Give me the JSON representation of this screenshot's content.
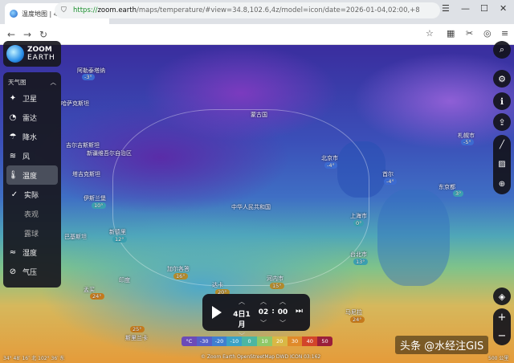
{
  "browser": {
    "tab_title": "温度地图 | 4日 1月，02:00 |",
    "tab_close": "×",
    "new_tab": "+",
    "url_scheme": "https://",
    "url_host": "zoom.earth",
    "url_path": "/maps/temperature/#view=34.8,102.6,4z/model=icon/date=2026-01-04,02:00,+8"
  },
  "logo": {
    "line1": "ZOOM",
    "line2": "EARTH"
  },
  "panel": {
    "header": "天气图",
    "items": [
      {
        "label": "卫星",
        "icon": "satellite-icon"
      },
      {
        "label": "雷达",
        "icon": "radar-icon"
      },
      {
        "label": "降水",
        "icon": "rain-icon"
      },
      {
        "label": "风",
        "icon": "wind-icon"
      },
      {
        "label": "温度",
        "icon": "thermometer-icon"
      },
      {
        "label": "实际",
        "icon": "check-icon"
      },
      {
        "label": "表观",
        "icon": ""
      },
      {
        "label": "露球",
        "icon": ""
      },
      {
        "label": "湿度",
        "icon": "humidity-icon"
      },
      {
        "label": "气压",
        "icon": "pressure-icon"
      }
    ]
  },
  "places": [
    {
      "name": "阿勒泰塔纳",
      "temp": "-3°"
    },
    {
      "name": "新疆维吾尔自治区",
      "temp": ""
    },
    {
      "name": "蒙古国",
      "temp": ""
    },
    {
      "name": "吉尔吉斯斯坦",
      "temp": ""
    },
    {
      "name": "哈萨克斯坦",
      "temp": ""
    },
    {
      "name": "塔吉克斯坦",
      "temp": ""
    },
    {
      "name": "伊斯兰堡",
      "temp": "10°"
    },
    {
      "name": "巴基斯坦",
      "temp": ""
    },
    {
      "name": "新德里",
      "temp": "12°"
    },
    {
      "name": "中华人民共和国",
      "temp": ""
    },
    {
      "name": "北京市",
      "temp": "-4°"
    },
    {
      "name": "首尔",
      "temp": "-4°"
    },
    {
      "name": "东京都",
      "temp": "3°"
    },
    {
      "name": "札幌市",
      "temp": "-5°"
    },
    {
      "name": "上海市",
      "temp": "0°"
    },
    {
      "name": "台北市",
      "temp": "13°"
    },
    {
      "name": "印度",
      "temp": ""
    },
    {
      "name": "加尔各答",
      "temp": "16°"
    },
    {
      "name": "孟买",
      "temp": "24°"
    },
    {
      "name": "达卡",
      "temp": "20°"
    },
    {
      "name": "河内市",
      "temp": "15°"
    },
    {
      "name": "曼谷",
      "temp": ""
    },
    {
      "name": "马尼拉",
      "temp": "24°"
    },
    {
      "name": "斯里兰卡",
      "temp": "25°"
    }
  ],
  "time": {
    "date": "4日1月",
    "hour": "02",
    "sep": ":",
    "minute": "00"
  },
  "legend": {
    "unit": "°C",
    "ticks": [
      "-30",
      "-20",
      "-10",
      "0",
      "10",
      "20",
      "30",
      "40",
      "50"
    ],
    "colors": [
      "#6b4bb8",
      "#5560c8",
      "#3f7fd0",
      "#3aa2c6",
      "#4cb6a2",
      "#8fc868",
      "#d9b845",
      "#e08a2a",
      "#d2452a",
      "#9a1e3a"
    ]
  },
  "footer": {
    "coords": "34° 48′ 16″ 北   102° 36′ 东",
    "credits": "© Zoom Earth  OpenStreetMap  DWD ICON 03:162",
    "scale": "500 公里"
  },
  "watermark": "头条 @水经注GIS"
}
